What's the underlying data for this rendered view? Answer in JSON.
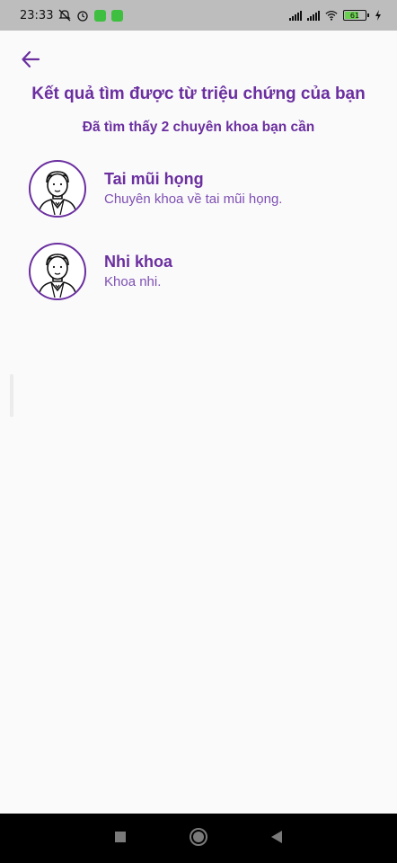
{
  "status_bar": {
    "time": "23:33",
    "battery_level": "61",
    "left_icons": [
      "muted-icon",
      "alarm-icon",
      "app-badge-icon",
      "app-badge-icon"
    ],
    "right_icons": [
      "signal-icon",
      "signal-icon",
      "wifi-icon",
      "battery-icon",
      "charging-icon"
    ]
  },
  "header": {
    "back_icon": "arrow-left-icon",
    "title": "Kết quả tìm được từ triệu chứng của bạn",
    "subtitle": "Đã tìm thấy 2 chuyên khoa bạn cần"
  },
  "results": [
    {
      "name": "Tai mũi họng",
      "description": "Chuyên khoa về tai mũi họng.",
      "icon": "doctor-avatar-icon"
    },
    {
      "name": "Nhi khoa",
      "description": "Khoa nhi.",
      "icon": "doctor-avatar-icon"
    }
  ],
  "nav": {
    "buttons": [
      "recents-button",
      "home-button",
      "back-button"
    ]
  },
  "colors": {
    "accent": "#6b2fa0",
    "status_bar": "#bdbdbd",
    "background": "#fafafa",
    "nav_bar": "#000000"
  }
}
